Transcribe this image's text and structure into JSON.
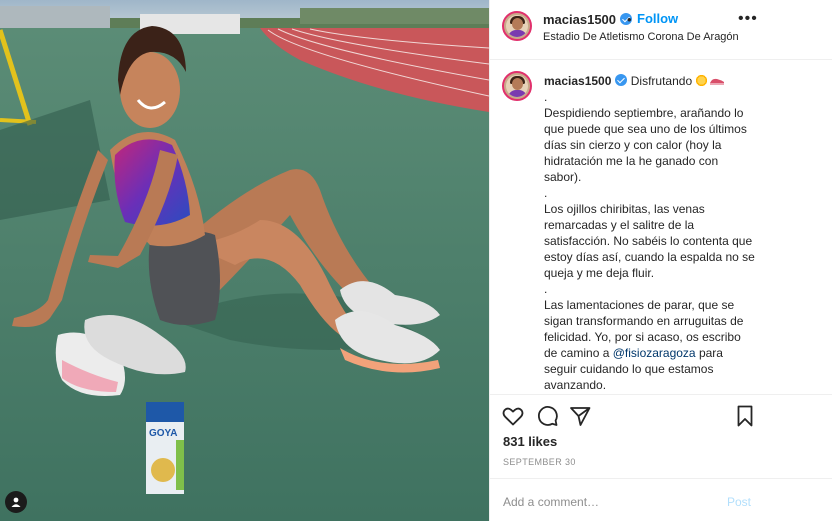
{
  "post": {
    "username": "macias1500",
    "follow_label": "Follow",
    "separator": "•",
    "location": "Estadio De Atletismo Corona De Aragón",
    "more_label": "•••"
  },
  "caption": {
    "first_line": "Disfrutando",
    "lines": [
      ".",
      "Despidiendo septiembre, arañando lo",
      "que puede que sea uno de los últimos",
      "días sin cierzo y con calor (hoy la",
      "hidratación me la he ganado con",
      "sabor).",
      ".",
      "Los ojillos chiribitas, las venas",
      "remarcadas y el salitre de la",
      "satisfacción. No sabéis lo contenta que",
      "estoy días así, cuando la espalda no se",
      "queja y me deja fluir.",
      ".",
      "Las lamentaciones de parar, que se",
      "sigan transformando en arruguitas de",
      "felicidad. Yo, por si acaso, os escribo"
    ],
    "mention_prefix": "de camino a ",
    "mention": "@fisiozaragoza",
    "mention_suffix": " para",
    "tail_lines": [
      "seguir cuidando lo que estamos",
      "avanzando."
    ]
  },
  "stats": {
    "likes": "831 likes",
    "date": "SEPTEMBER 30"
  },
  "comment": {
    "placeholder": "Add a comment…",
    "post_label": "Post"
  },
  "photo": {
    "carton_brand": "GOYA"
  },
  "colors": {
    "follow": "#0095f6",
    "verified": "#3897f0",
    "track_green": "#4d7f69",
    "track_red": "#c9575a"
  }
}
